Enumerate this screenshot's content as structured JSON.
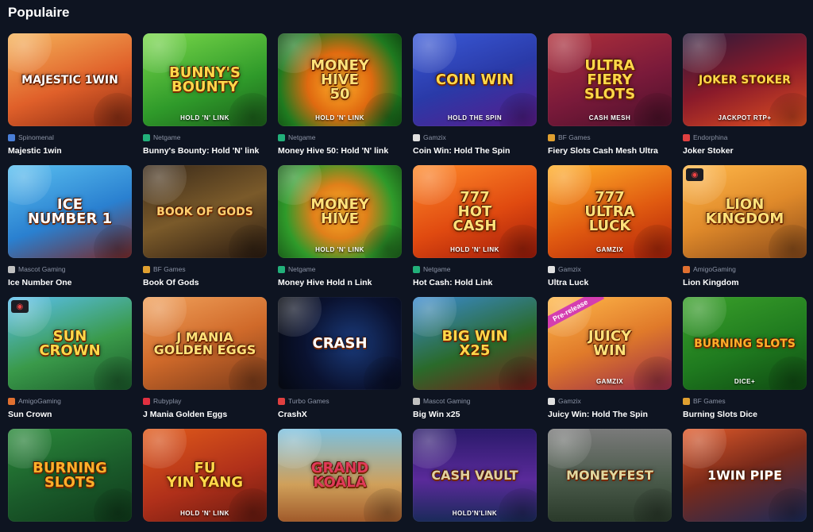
{
  "section": {
    "title": "Populaire"
  },
  "games": [
    {
      "name": "Majestic 1win",
      "provider": "Spinomenal",
      "provider_color": "#4a7fd8",
      "thumb_text": "MAJESTIC 1WIN",
      "thumb_sub": "",
      "bg": "linear-gradient(160deg,#f5b45a 0%,#e0602a 55%,#8a2a12 100%)",
      "title_color": "#ffffff",
      "badge": ""
    },
    {
      "name": "Bunny's Bounty: Hold 'N' link",
      "provider": "Netgame",
      "provider_color": "#22b07a",
      "thumb_text": "BUNNY'S\nBOUNTY",
      "thumb_sub": "HOLD 'N' LINK",
      "bg": "linear-gradient(160deg,#7ad84a 0%,#2f9a2a 60%,#1b5e1a 100%)",
      "title_color": "#ffd84a",
      "badge": ""
    },
    {
      "name": "Money Hive 50: Hold 'N' link",
      "provider": "Netgame",
      "provider_color": "#22b07a",
      "thumb_text": "MONEY\nHIVE\n50",
      "thumb_sub": "HOLD 'N' LINK",
      "bg": "radial-gradient(circle at 50% 55%,#ffb02a 0%,#e06a10 40%,#1f7a1f 75%,#0f4a12 100%)",
      "title_color": "#ffe27a",
      "badge": ""
    },
    {
      "name": "Coin Win: Hold The Spin",
      "provider": "Gamzix",
      "provider_color": "#e0e0e0",
      "thumb_text": "COIN WIN",
      "thumb_sub": "HOLD THE SPIN",
      "bg": "linear-gradient(160deg,#3a5ad8 0%,#2a3aa8 50%,#5a1a8a 100%)",
      "title_color": "#ffd84a",
      "badge": ""
    },
    {
      "name": "Fiery Slots Cash Mesh Ultra",
      "provider": "BF Games",
      "provider_color": "#e0a030",
      "thumb_text": "ULTRA\nFIERY\nSLOTS",
      "thumb_sub": "CASH MESH",
      "bg": "linear-gradient(160deg,#b0303a 0%,#7a1a3a 55%,#4a102a 100%)",
      "title_color": "#ffd84a",
      "badge": ""
    },
    {
      "name": "Joker Stoker",
      "provider": "Endorphina",
      "provider_color": "#e04040",
      "thumb_text": "JOKER STOKER",
      "thumb_sub": "JACKPOT RTP+",
      "bg": "linear-gradient(160deg,#2a1a3a 0%,#8a1a2a 50%,#e05020 100%)",
      "title_color": "#ffd84a",
      "badge": ""
    },
    {
      "name": "Ice Number One",
      "provider": "Mascot Gaming",
      "provider_color": "#c0c0c0",
      "thumb_text": "ICE\nNUMBER 1",
      "thumb_sub": "",
      "bg": "linear-gradient(160deg,#5ac0f0 0%,#2a80d0 55%,#7a2a2a 100%)",
      "title_color": "#ffffff",
      "badge": ""
    },
    {
      "name": "Book Of Gods",
      "provider": "BF Games",
      "provider_color": "#e0a030",
      "thumb_text": "BOOK OF GODS",
      "thumb_sub": "",
      "bg": "linear-gradient(160deg,#3a2a1a 0%,#7a5a2a 50%,#2a1a10 100%)",
      "title_color": "#ffd070",
      "badge": ""
    },
    {
      "name": "Money Hive Hold n Link",
      "provider": "Netgame",
      "provider_color": "#22b07a",
      "thumb_text": "MONEY\nHIVE",
      "thumb_sub": "HOLD 'N' LINK",
      "bg": "radial-gradient(circle at 50% 50%,#ffb02a 0%,#e0801a 35%,#2f9a2a 70%,#1b5e1a 100%)",
      "title_color": "#ffe27a",
      "badge": ""
    },
    {
      "name": "Hot Cash: Hold Link",
      "provider": "Netgame",
      "provider_color": "#22b07a",
      "thumb_text": "777\nHOT\nCASH",
      "thumb_sub": "HOLD 'N' LINK",
      "bg": "linear-gradient(160deg,#ff8a2a 0%,#e04a10 55%,#a01a0a 100%)",
      "title_color": "#ffe27a",
      "badge": ""
    },
    {
      "name": "Ultra Luck",
      "provider": "Gamzix",
      "provider_color": "#e0e0e0",
      "thumb_text": "777\nULTRA\nLUCK",
      "thumb_sub": "GAMZIX",
      "bg": "linear-gradient(160deg,#ffb02a 0%,#e05a10 55%,#b0200a 100%)",
      "title_color": "#ffe27a",
      "badge": ""
    },
    {
      "name": "Lion Kingdom",
      "provider": "AmigoGaming",
      "provider_color": "#e07030",
      "thumb_text": "LION\nKINGDOM",
      "thumb_sub": "",
      "bg": "linear-gradient(160deg,#ffb84a 0%,#e08a2a 50%,#8a4a1a 100%)",
      "title_color": "#ffe27a",
      "badge": "corner"
    },
    {
      "name": "Sun Crown",
      "provider": "AmigoGaming",
      "provider_color": "#e07030",
      "thumb_text": "SUN\nCROWN",
      "thumb_sub": "",
      "bg": "linear-gradient(160deg,#5ac0f0 0%,#3a9a4a 55%,#1a5a2a 100%)",
      "title_color": "#ffd84a",
      "badge": "corner"
    },
    {
      "name": "J Mania Golden Eggs",
      "provider": "Rubyplay",
      "provider_color": "#e03040",
      "thumb_text": "J MANIA\nGolden eggs",
      "thumb_sub": "",
      "bg": "linear-gradient(160deg,#f0a05a 0%,#d06a2a 50%,#7a3a1a 100%)",
      "title_color": "#ffe27a",
      "badge": ""
    },
    {
      "name": "CrashX",
      "provider": "Turbo Games",
      "provider_color": "#e04040",
      "thumb_text": "CRASH",
      "thumb_sub": "",
      "bg": "radial-gradient(circle at 60% 50%,#1a3a7a 0%,#0a1230 55%,#05080f 100%)",
      "title_color": "#ffffff",
      "badge": ""
    },
    {
      "name": "Big Win x25",
      "provider": "Mascot Gaming",
      "provider_color": "#c0c0c0",
      "thumb_text": "BIG WIN\nx25",
      "thumb_sub": "",
      "bg": "linear-gradient(160deg,#3a8ad0 0%,#2a6a2a 55%,#7a1a1a 100%)",
      "title_color": "#ffd84a",
      "badge": ""
    },
    {
      "name": "Juicy Win: Hold The Spin",
      "provider": "Gamzix",
      "provider_color": "#e0e0e0",
      "thumb_text": "JUICY\nWin",
      "thumb_sub": "GAMZIX",
      "bg": "linear-gradient(160deg,#ffb84a 0%,#e07a2a 50%,#9a2a4a 100%)",
      "title_color": "#ffe27a",
      "badge": "Pre-release"
    },
    {
      "name": "Burning Slots Dice",
      "provider": "BF Games",
      "provider_color": "#e0a030",
      "thumb_text": "BURNING SLOTS",
      "thumb_sub": "DICE+",
      "bg": "linear-gradient(160deg,#3aa02a 0%,#1f7a1f 55%,#0f4a12 100%)",
      "title_color": "#ffb02a",
      "badge": ""
    },
    {
      "name": "",
      "provider": "",
      "provider_color": "#000000",
      "thumb_text": "BURNING\nSLOTS",
      "thumb_sub": "",
      "bg": "linear-gradient(160deg,#2a8a3a 0%,#1a5a2a 55%,#0f3a1a 100%)",
      "title_color": "#ffb02a",
      "badge": ""
    },
    {
      "name": "",
      "provider": "",
      "provider_color": "#000000",
      "thumb_text": "FU\nYIN YANG",
      "thumb_sub": "HOLD 'N' LINK",
      "bg": "linear-gradient(160deg,#e05a1a 0%,#b0301a 55%,#6a1a10 100%)",
      "title_color": "#ffd84a",
      "badge": ""
    },
    {
      "name": "",
      "provider": "",
      "provider_color": "#000000",
      "thumb_text": "GRAND\nKOALA",
      "thumb_sub": "",
      "bg": "linear-gradient(180deg,#7ac0e0 0%,#d0a05a 60%,#a05a2a 100%)",
      "title_color": "#e03a5a",
      "badge": ""
    },
    {
      "name": "",
      "provider": "",
      "provider_color": "#000000",
      "thumb_text": "CASH VAULT",
      "thumb_sub": "HOLD'N'LINK",
      "bg": "linear-gradient(180deg,#2a1a6a 0%,#5a2a9a 55%,#1a2a5a 100%)",
      "title_color": "#e0d0a0",
      "badge": ""
    },
    {
      "name": "",
      "provider": "",
      "provider_color": "#000000",
      "thumb_text": "MONEYFEST",
      "thumb_sub": "",
      "bg": "linear-gradient(180deg,#7a7a7a 0%,#4a5a4a 55%,#2a3a2a 100%)",
      "title_color": "#e0d8a0",
      "badge": ""
    },
    {
      "name": "",
      "provider": "",
      "provider_color": "#000000",
      "thumb_text": "1win pipe",
      "thumb_sub": "",
      "bg": "linear-gradient(160deg,#e05a2a 0%,#7a2a1a 45%,#1a2a5a 100%)",
      "title_color": "#ffffff",
      "badge": ""
    }
  ]
}
